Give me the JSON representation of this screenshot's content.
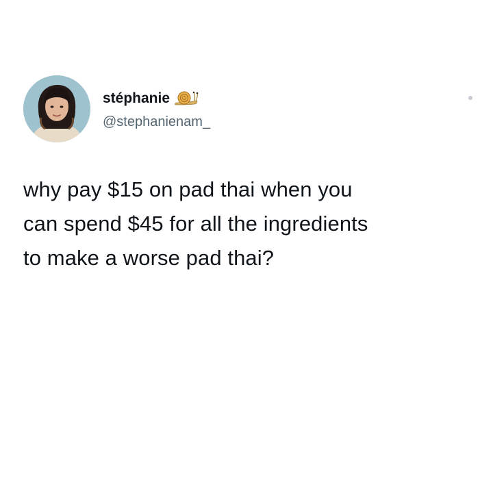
{
  "tweet": {
    "author": {
      "display_name": "stéphanie",
      "name_emoji_icon": "snail-icon",
      "handle": "@stephanienam_",
      "avatar_icon": "avatar-photo"
    },
    "menu_icon": "more-options-dot",
    "text": "why pay $15 on pad thai when you\ncan spend $45 for all the ingredients\nto make a worse pad thai?"
  },
  "colors": {
    "background": "#ffffff",
    "text_primary": "#0f1419",
    "text_secondary": "#536471",
    "avatar_bg": "#9ec3cf"
  }
}
